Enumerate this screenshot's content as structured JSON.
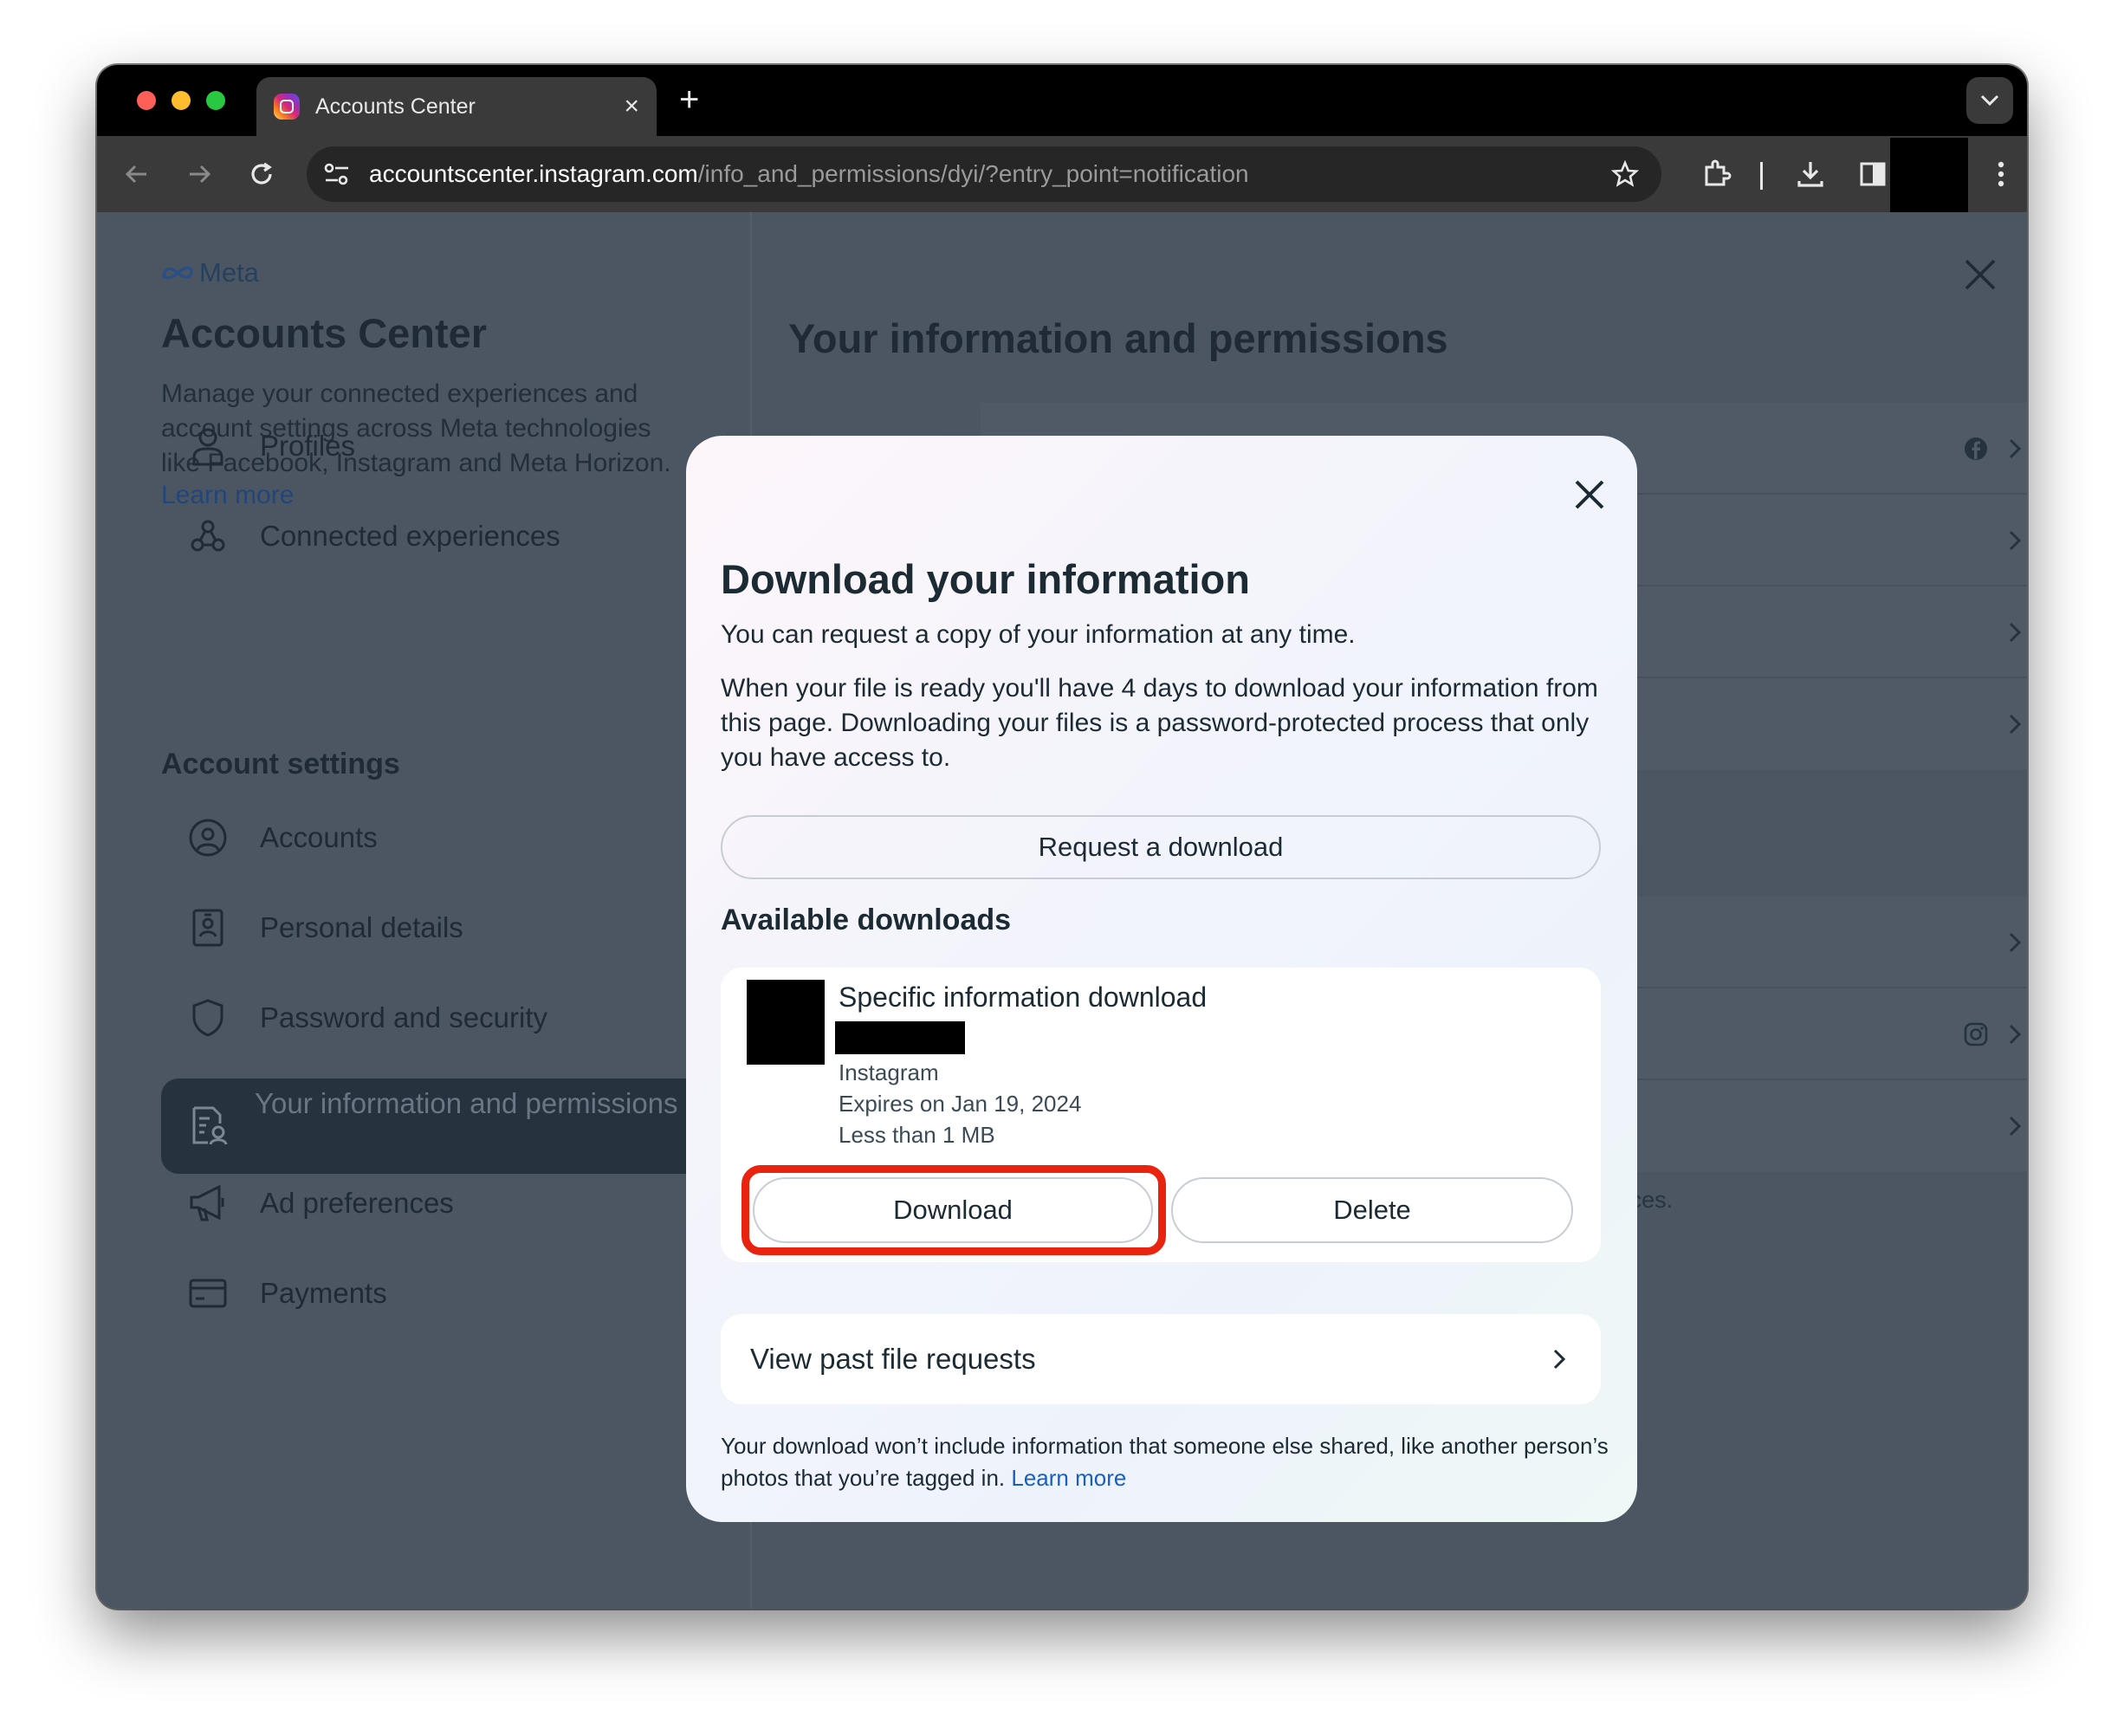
{
  "browser": {
    "tab_title": "Accounts Center",
    "url_domain": "accountscenter.instagram.com",
    "url_path": "/info_and_permissions/dyi/?entry_point=notification",
    "new_tab": "+",
    "tab_close": "×"
  },
  "sidebar": {
    "brand": "Meta",
    "title": "Accounts Center",
    "description_lines": [
      "Manage your connected experiences and",
      "account settings across Meta technologies",
      "like Facebook, Instagram and Meta Horizon."
    ],
    "learn_more": "Learn more",
    "items": [
      {
        "label": "Profiles",
        "icon": "person-icon"
      },
      {
        "label": "Connected experiences",
        "icon": "connected-icon"
      }
    ],
    "section_label": "Account settings",
    "settings_items": [
      {
        "label": "Accounts",
        "icon": "account-circle-icon"
      },
      {
        "label": "Personal details",
        "icon": "id-card-icon"
      },
      {
        "label": "Password and security",
        "icon": "shield-icon"
      },
      {
        "label": "Your information and permissions",
        "icon": "info-doc-icon",
        "active": true
      },
      {
        "label": "Ad preferences",
        "icon": "megaphone-icon"
      },
      {
        "label": "Payments",
        "icon": "credit-card-icon"
      }
    ]
  },
  "main": {
    "title": "Your information and permissions",
    "note_fragment": "experiences."
  },
  "modal": {
    "title": "Download your information",
    "intro": "You can request a copy of your information at any time.",
    "body": "When your file is ready you'll have 4 days to download your information from this page. Downloading your files is a password-protected process that only you have access to.",
    "request_button": "Request a download",
    "available_heading": "Available downloads",
    "download_item": {
      "title": "Specific information download",
      "source": "Instagram",
      "expires": "Expires on Jan 19, 2024",
      "size": "Less than 1 MB",
      "download_button": "Download",
      "delete_button": "Delete"
    },
    "past_requests": "View past file requests",
    "footer": "Your download won’t include information that someone else shared, like another person’s photos that you’re tagged in.",
    "footer_link": "Learn more"
  },
  "colors": {
    "highlight": "#e8230f",
    "link": "#1a5fbf",
    "active_nav": "#26323d"
  }
}
